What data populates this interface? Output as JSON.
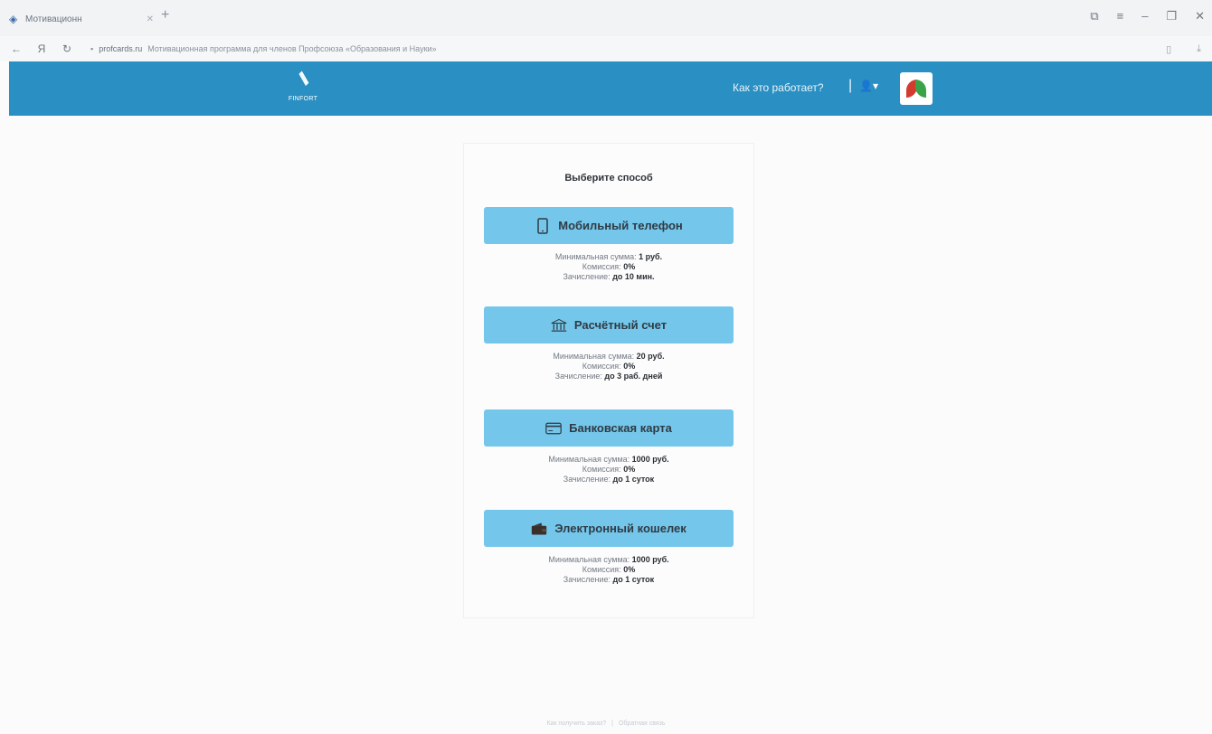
{
  "browser": {
    "tab_title": "Мотивационн",
    "url_domain": "profcards.ru",
    "page_title": "Мотивационная программа для членов Профсоюза «Образования и Науки»"
  },
  "header": {
    "brand": "FINFORT",
    "how_it_works": "Как это работает?",
    "separator": "|"
  },
  "card": {
    "title": "Выберите способ",
    "methods": [
      {
        "label": "Мобильный телефон",
        "icon": "mobile-phone-icon",
        "min_label": "Минимальная сумма:",
        "min_value": "1 руб.",
        "fee_label": "Комиссия:",
        "fee_value": "0%",
        "credit_label": "Зачисление:",
        "credit_value": "до 10 мин."
      },
      {
        "label": "Расчётный счет",
        "icon": "bank-icon",
        "min_label": "Минимальная сумма:",
        "min_value": "20 руб.",
        "fee_label": "Комиссия:",
        "fee_value": "0%",
        "credit_label": "Зачисление:",
        "credit_value": "до 3 раб. дней"
      },
      {
        "label": "Банковская карта",
        "icon": "credit-card-icon",
        "min_label": "Минимальная сумма:",
        "min_value": "1000 руб.",
        "fee_label": "Комиссия:",
        "fee_value": "0%",
        "credit_label": "Зачисление:",
        "credit_value": "до 1 суток"
      },
      {
        "label": "Электронный кошелек",
        "icon": "wallet-icon",
        "min_label": "Минимальная сумма:",
        "min_value": "1000 руб.",
        "fee_label": "Комиссия:",
        "fee_value": "0%",
        "credit_label": "Зачисление:",
        "credit_value": "до 1 суток"
      }
    ]
  },
  "footer": {
    "link1": "Как получить заказ?",
    "link2": "Обратная связь"
  },
  "colors": {
    "header_bg": "#2a8fc2",
    "button_bg": "#74c7ea"
  }
}
